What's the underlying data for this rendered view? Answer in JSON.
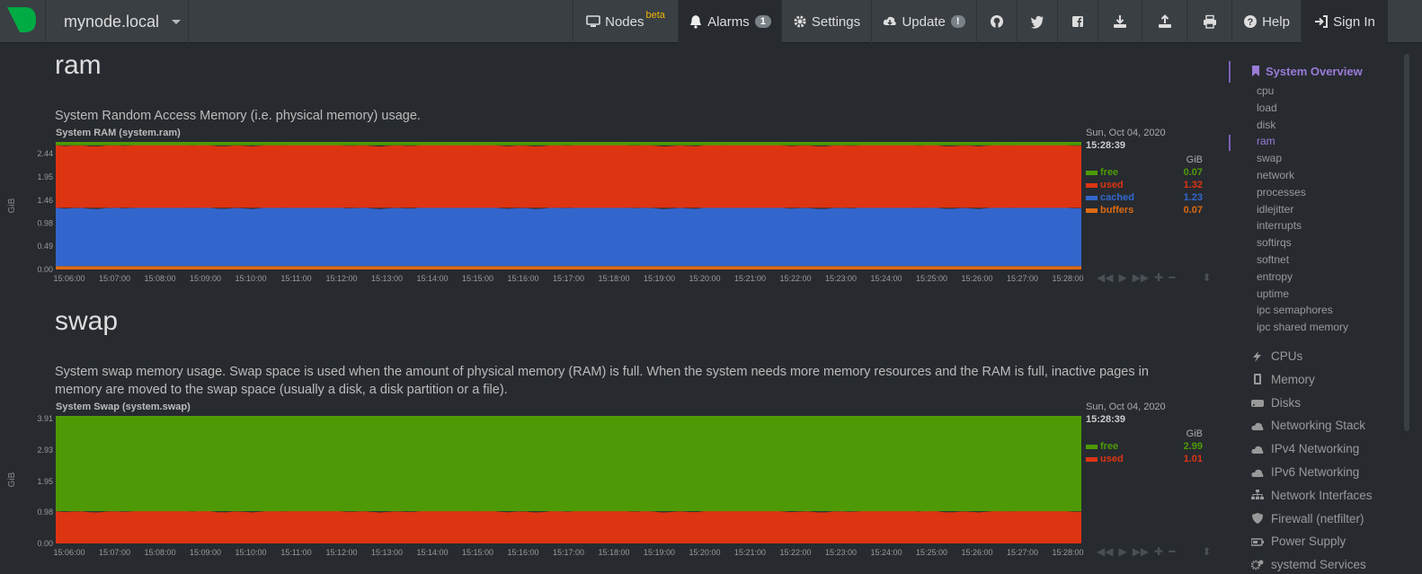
{
  "navbar": {
    "hostname": "mynode.local",
    "nodes": "Nodes",
    "nodes_beta": "beta",
    "alarms": "Alarms",
    "alarms_count": "1",
    "settings": "Settings",
    "update": "Update",
    "update_badge": "!",
    "help": "Help",
    "sign_in": "Sign In"
  },
  "sections": {
    "ram": {
      "title": "ram",
      "description": "System Random Access Memory (i.e. physical memory) usage."
    },
    "swap": {
      "title": "swap",
      "description": "System swap memory usage. Swap space is used when the amount of physical memory (RAM) is full. When the system needs more memory resources and the RAM is full, inactive pages in memory are moved to the swap space (usually a disk, a disk partition or a file)."
    }
  },
  "chart_data": [
    {
      "type": "area",
      "title": "System RAM (system.ram)",
      "ylabel": "GiB",
      "units": "GiB",
      "stacked": true,
      "ylim": [
        0,
        2.69
      ],
      "yticks": [
        "0.00",
        "0.49",
        "0.98",
        "1.46",
        "1.95",
        "2.44"
      ],
      "xticks": [
        "15:06:00",
        "15:07:00",
        "15:08:00",
        "15:09:00",
        "15:10:00",
        "15:11:00",
        "15:12:00",
        "15:13:00",
        "15:14:00",
        "15:15:00",
        "15:16:00",
        "15:17:00",
        "15:18:00",
        "15:19:00",
        "15:20:00",
        "15:21:00",
        "15:22:00",
        "15:23:00",
        "15:24:00",
        "15:25:00",
        "15:26:00",
        "15:27:00",
        "15:28:00"
      ],
      "date": "Sun, Oct 04, 2020",
      "time": "15:28:39",
      "series": [
        {
          "name": "free",
          "value": 0.07,
          "label": "0.07",
          "color": "#4e9a06"
        },
        {
          "name": "used",
          "value": 1.32,
          "label": "1.32",
          "color": "#dd3412"
        },
        {
          "name": "cached",
          "value": 1.23,
          "label": "1.23",
          "color": "#3366cc"
        },
        {
          "name": "buffers",
          "value": 0.07,
          "label": "0.07",
          "color": "#dd6a12"
        }
      ]
    },
    {
      "type": "area",
      "title": "System Swap (system.swap)",
      "ylabel": "GiB",
      "units": "GiB",
      "stacked": true,
      "ylim": [
        0,
        4.0
      ],
      "yticks": [
        "0.00",
        "0.98",
        "1.95",
        "2.93",
        "3.91"
      ],
      "xticks": [
        "15:06:00",
        "15:07:00",
        "15:08:00",
        "15:09:00",
        "15:10:00",
        "15:11:00",
        "15:12:00",
        "15:13:00",
        "15:14:00",
        "15:15:00",
        "15:16:00",
        "15:17:00",
        "15:18:00",
        "15:19:00",
        "15:20:00",
        "15:21:00",
        "15:22:00",
        "15:23:00",
        "15:24:00",
        "15:25:00",
        "15:26:00",
        "15:27:00",
        "15:28:00"
      ],
      "date": "Sun, Oct 04, 2020",
      "time": "15:28:39",
      "series": [
        {
          "name": "free",
          "value": 2.99,
          "label": "2.99",
          "color": "#4e9a06"
        },
        {
          "name": "used",
          "value": 1.01,
          "label": "1.01",
          "color": "#dd3412"
        }
      ]
    }
  ],
  "sidebar": {
    "heading": "System Overview",
    "subitems": [
      "cpu",
      "load",
      "disk",
      "ram",
      "swap",
      "network",
      "processes",
      "idlejitter",
      "interrupts",
      "softirqs",
      "softnet",
      "entropy",
      "uptime",
      "ipc semaphores",
      "ipc shared memory"
    ],
    "current": "ram",
    "sections": [
      {
        "label": "CPUs",
        "icon": "bolt-icon"
      },
      {
        "label": "Memory",
        "icon": "memory-icon"
      },
      {
        "label": "Disks",
        "icon": "hdd-icon"
      },
      {
        "label": "Networking Stack",
        "icon": "cloud-icon"
      },
      {
        "label": "IPv4 Networking",
        "icon": "cloud-icon"
      },
      {
        "label": "IPv6 Networking",
        "icon": "cloud-icon"
      },
      {
        "label": "Network Interfaces",
        "icon": "sitemap-icon"
      },
      {
        "label": "Firewall (netfilter)",
        "icon": "shield-icon"
      },
      {
        "label": "Power Supply",
        "icon": "battery-icon"
      },
      {
        "label": "systemd Services",
        "icon": "gears-icon"
      }
    ]
  }
}
